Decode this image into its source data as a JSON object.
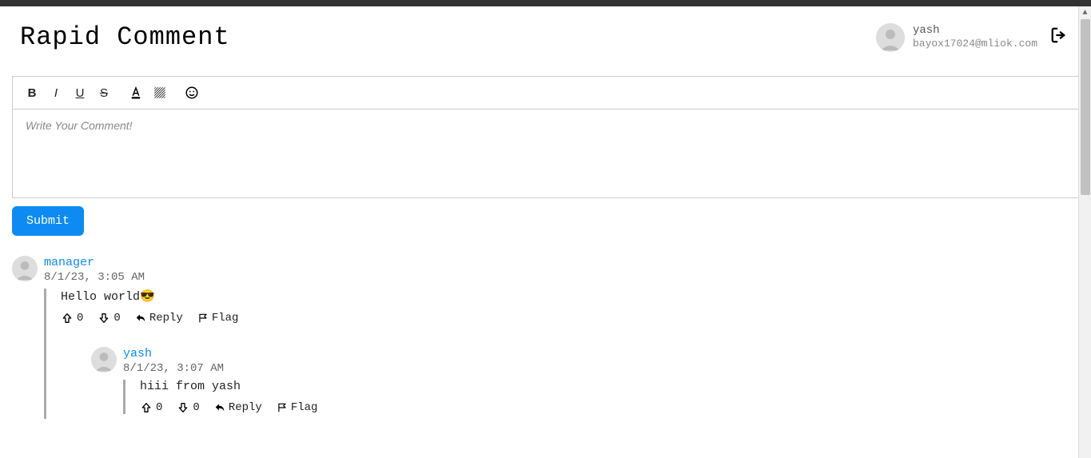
{
  "header": {
    "title": "Rapid Comment",
    "username": "yash",
    "email": "bayox17024@mliok.com"
  },
  "editor": {
    "placeholder": "Write Your Comment!",
    "submit_label": "Submit"
  },
  "actions": {
    "reply": "Reply",
    "flag": "Flag"
  },
  "comments": [
    {
      "author": "manager",
      "time": "8/1/23, 3:05 AM",
      "text": "Hello world😎",
      "upvotes": "0",
      "downvotes": "0",
      "replies": [
        {
          "author": "yash",
          "time": "8/1/23, 3:07 AM",
          "text": "hiii from yash",
          "upvotes": "0",
          "downvotes": "0"
        }
      ]
    }
  ]
}
